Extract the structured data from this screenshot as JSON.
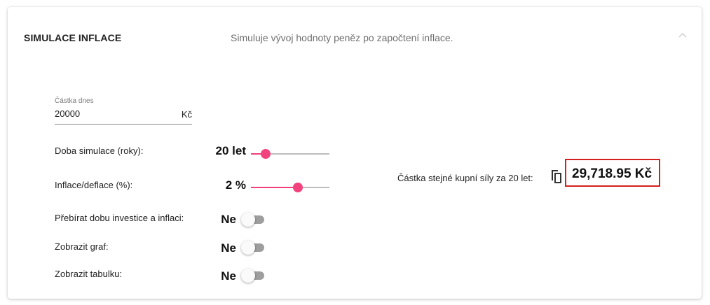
{
  "panel": {
    "title": "SIMULACE INFLACE",
    "description": "Simuluje vývoj hodnoty peněz po započtení inflace.",
    "collapse_icon": "chevron-up-icon"
  },
  "amount": {
    "label": "Částka dnes",
    "value": "20000",
    "suffix": "Kč"
  },
  "duration": {
    "label": "Doba simulace (roky):",
    "value_text": "20 let",
    "slider_fraction": 0.19
  },
  "inflation": {
    "label": "Inflace/deflace (%):",
    "value_text": "2 %",
    "slider_fraction": 0.6
  },
  "toggles": [
    {
      "label": "Přebírat dobu investice a inflaci:",
      "value_text": "Ne",
      "on": false
    },
    {
      "label": "Zobrazit graf:",
      "value_text": "Ne",
      "on": false
    },
    {
      "label": "Zobrazit tabulku:",
      "value_text": "Ne",
      "on": false
    }
  ],
  "result": {
    "label": "Částka stejné kupní síly za 20 let:",
    "copy_icon": "copy-icon",
    "value": "29,718.95 Kč",
    "highlight_color": "#d32020"
  },
  "colors": {
    "accent": "#f3437f",
    "toggle_off": "#9e9e9e"
  }
}
